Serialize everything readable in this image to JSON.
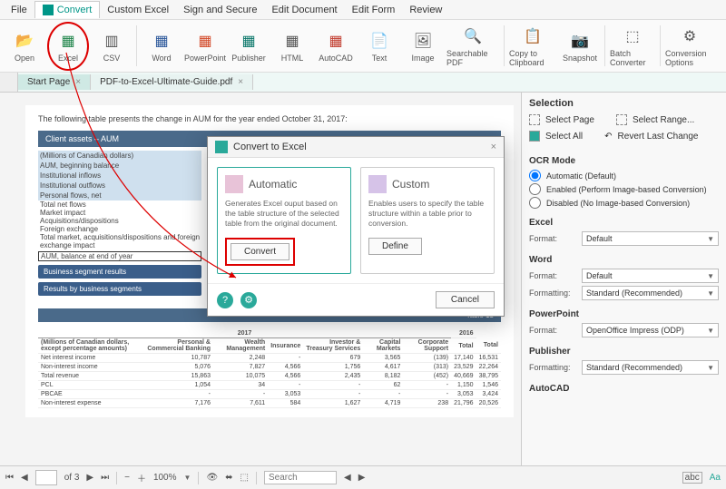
{
  "menubar": {
    "items": [
      "File",
      "Convert",
      "Custom Excel",
      "Sign and Secure",
      "Edit Document",
      "Edit Form",
      "Review"
    ]
  },
  "ribbon": {
    "items": [
      "Open",
      "Excel",
      "CSV",
      "Word",
      "PowerPoint",
      "Publisher",
      "HTML",
      "AutoCAD",
      "Text",
      "Image",
      "Searchable PDF",
      "Copy to Clipboard",
      "Snapshot",
      "Batch Converter",
      "Conversion Options"
    ]
  },
  "tabs": {
    "items": [
      {
        "label": "Start Page"
      },
      {
        "label": "PDF-to-Excel-Ultimate-Guide.pdf"
      }
    ]
  },
  "doc": {
    "intro": "The following table presents the change in AUM for the year ended October 31, 2017:",
    "band1": "Client assets – AUM",
    "rows_hl": [
      "(Millions of Canadian dollars)",
      "AUM, beginning balance",
      "Institutional inflows",
      "Institutional outflows",
      "Personal flows, net"
    ],
    "rows_plain": [
      "Total net flows",
      "  Market impact",
      "  Acquisitions/dispositions",
      "  Foreign exchange",
      "Total market, acquisitions/dispositions and foreign exchange impact"
    ],
    "row_boxed": "AUM, balance at end of year",
    "pill1": "Business segment results",
    "pill2": "Results by business segments",
    "band2_right": "Table 13",
    "years": {
      "y1": "2017",
      "y2": "2016"
    },
    "cols": [
      "Personal & Commercial Banking",
      "Wealth Management",
      "Insurance",
      "Investor & Treasury Services",
      "Capital Markets",
      "Corporate Support",
      "Total",
      "Total"
    ],
    "note": "(Millions of Canadian dollars, except percentage amounts)",
    "data_rows": [
      {
        "label": "Net interest income",
        "v": [
          "10,787",
          "2,248",
          "-",
          "679",
          "3,565",
          "(139)",
          "17,140",
          "16,531"
        ]
      },
      {
        "label": "Non-interest income",
        "v": [
          "5,076",
          "7,827",
          "4,566",
          "1,756",
          "4,617",
          "(313)",
          "23,529",
          "22,264"
        ]
      },
      {
        "label": "Total revenue",
        "v": [
          "15,863",
          "10,075",
          "4,566",
          "2,435",
          "8,182",
          "(452)",
          "40,669",
          "38,795"
        ]
      },
      {
        "label": "PCL",
        "v": [
          "1,054",
          "34",
          "-",
          "-",
          "62",
          "-",
          "1,150",
          "1,546"
        ]
      },
      {
        "label": "PBCAE",
        "v": [
          "-",
          "-",
          "3,053",
          "-",
          "-",
          "-",
          "3,053",
          "3,424"
        ]
      },
      {
        "label": "Non-interest expense",
        "v": [
          "7,176",
          "7,611",
          "584",
          "1,627",
          "4,719",
          "238",
          "21,796",
          "20,526"
        ]
      }
    ]
  },
  "dialog": {
    "title": "Convert to Excel",
    "auto": {
      "title": "Automatic",
      "desc": "Generates Excel ouput based on the table structure of the selected table from the original document.",
      "btn": "Convert"
    },
    "custom": {
      "title": "Custom",
      "desc": "Enables users to specify the table structure within a table prior to conversion.",
      "btn": "Define"
    },
    "cancel": "Cancel"
  },
  "rpanel": {
    "selection_title": "Selection",
    "select_page": "Select Page",
    "select_range": "Select Range...",
    "select_all": "Select All",
    "revert": "Revert Last Change",
    "ocr_title": "OCR Mode",
    "ocr_opts": [
      "Automatic (Default)",
      "Enabled (Perform Image-based Conversion)",
      "Disabled (No Image-based Conversion)"
    ],
    "excel_title": "Excel",
    "word_title": "Word",
    "ppt_title": "PowerPoint",
    "pub_title": "Publisher",
    "autocad_title": "AutoCAD",
    "format_label": "Format:",
    "formatting_label": "Formatting:",
    "default_val": "Default",
    "std_val": "Standard (Recommended)",
    "ppt_val": "OpenOffice Impress (ODP)",
    "rev_glyph": "↶"
  },
  "status": {
    "page_of": "of 3",
    "zoom": "100%",
    "search_ph": "Search",
    "tool_abc": "abc",
    "tool_aa": "Aa"
  }
}
